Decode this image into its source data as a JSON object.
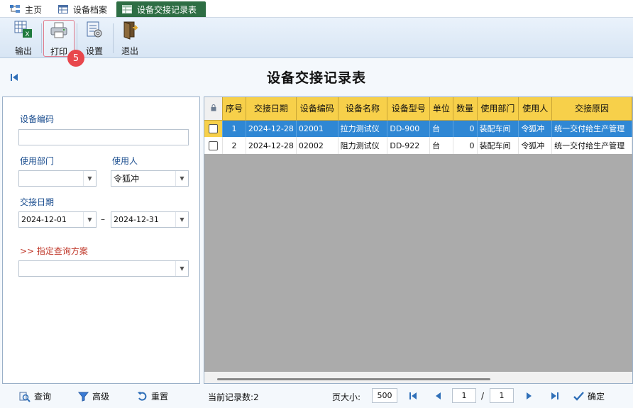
{
  "tabs": [
    {
      "label": "主页",
      "icon": "home-tree-icon"
    },
    {
      "label": "设备档案",
      "icon": "table-icon"
    },
    {
      "label": "设备交接记录表",
      "icon": "table-icon",
      "active": true
    }
  ],
  "toolbar": {
    "export_label": "输出",
    "print_label": "打印",
    "settings_label": "设置",
    "exit_label": "退出",
    "step_badge": "5"
  },
  "page_title": "设备交接记录表",
  "filters": {
    "device_code_label": "设备编码",
    "device_code_value": "",
    "dept_label": "使用部门",
    "dept_value": "",
    "user_label": "使用人",
    "user_value": "令狐冲",
    "date_label": "交接日期",
    "date_from": "2024-12-01",
    "date_sep": "–",
    "date_to": "2024-12-31",
    "scheme_label": ">> 指定查询方案",
    "scheme_value": ""
  },
  "grid": {
    "columns": [
      "序号",
      "交接日期",
      "设备编码",
      "设备名称",
      "设备型号",
      "单位",
      "数量",
      "使用部门",
      "使用人",
      "交接原因"
    ],
    "rows": [
      [
        "1",
        "2024-12-28",
        "02001",
        "拉力测试仪",
        "DD-900",
        "台",
        "0",
        "装配车间",
        "令狐冲",
        "统一交付给生产管理"
      ],
      [
        "2",
        "2024-12-28",
        "02002",
        "阻力测试仪",
        "DD-922",
        "台",
        "0",
        "装配车间",
        "令狐冲",
        "统一交付给生产管理"
      ]
    ]
  },
  "bottom": {
    "query_label": "查询",
    "advanced_label": "高级",
    "reset_label": "重置",
    "record_count": "当前记录数:2",
    "page_size_label": "页大小:",
    "page_size": "500",
    "page_current": "1",
    "page_sep": "/",
    "page_total": "1",
    "confirm_label": "确定"
  },
  "colors": {
    "active_tab": "#2e6e44",
    "header_yellow": "#f7d04a",
    "selected_row": "#2f87d4",
    "badge_red": "#e8474c",
    "label_blue": "#1a4d8f",
    "scheme_red": "#c0392b"
  }
}
